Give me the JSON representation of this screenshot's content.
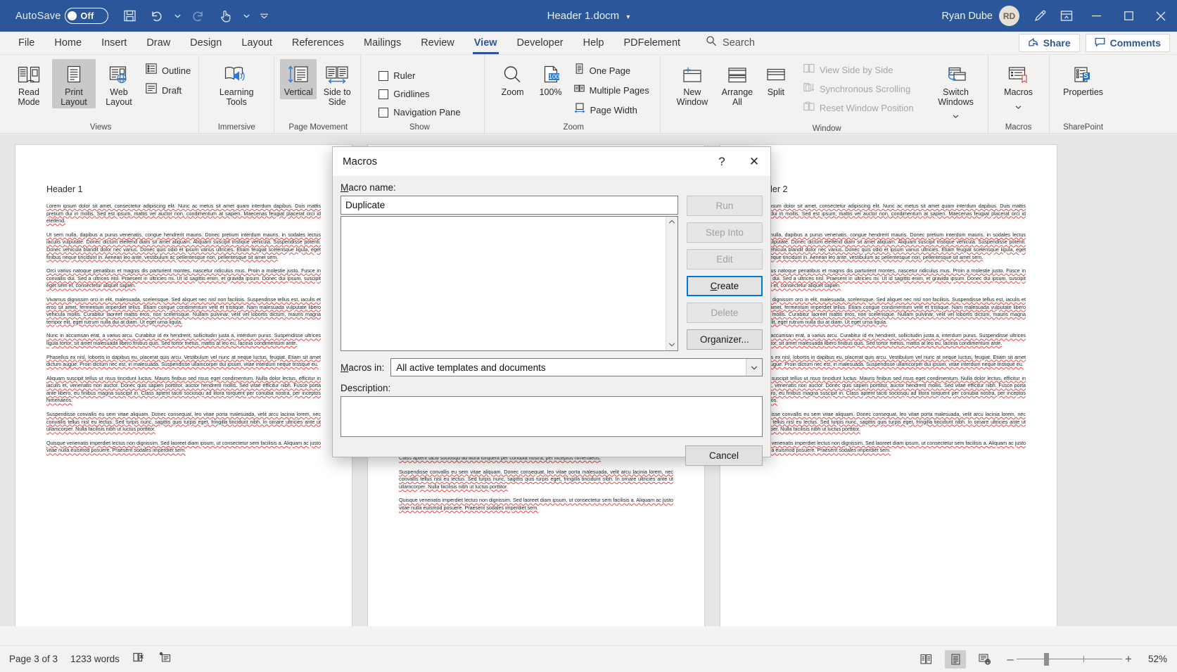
{
  "titlebar": {
    "autosave_label": "AutoSave",
    "autosave_state": "Off",
    "save_icon": "save-icon",
    "undo_icon": "undo-icon",
    "redo_icon": "redo-icon",
    "touch_icon": "touch-mode-icon",
    "customize_icon": "customize-quick-access-icon",
    "document_title": "Header 1.docm",
    "title_caret": "▾",
    "user_name": "Ryan Dube",
    "avatar_initials": "RD",
    "pen_icon": "ink-pen-icon",
    "ribbon_display_icon": "ribbon-display-options-icon",
    "minimize": "–",
    "maximize": "□",
    "close": "✕"
  },
  "tabs": [
    {
      "label": "File",
      "active": false
    },
    {
      "label": "Home",
      "active": false
    },
    {
      "label": "Insert",
      "active": false
    },
    {
      "label": "Draw",
      "active": false
    },
    {
      "label": "Design",
      "active": false
    },
    {
      "label": "Layout",
      "active": false
    },
    {
      "label": "References",
      "active": false
    },
    {
      "label": "Mailings",
      "active": false
    },
    {
      "label": "Review",
      "active": false
    },
    {
      "label": "View",
      "active": true
    },
    {
      "label": "Developer",
      "active": false
    },
    {
      "label": "Help",
      "active": false
    },
    {
      "label": "PDFelement",
      "active": false
    }
  ],
  "search": {
    "placeholder": "Search",
    "icon": "search-icon"
  },
  "tabbar_right": {
    "share_label": "Share",
    "share_icon": "share-icon",
    "comments_label": "Comments",
    "comments_icon": "comment-icon"
  },
  "ribbon": {
    "groups": [
      {
        "label": "Views",
        "items": [
          {
            "label": "Read Mode",
            "selected": false,
            "icon": "read-mode-icon"
          },
          {
            "label": "Print Layout",
            "selected": true,
            "icon": "print-layout-icon"
          },
          {
            "label": "Web Layout",
            "selected": false,
            "icon": "web-layout-icon"
          }
        ],
        "small_items": [
          {
            "label": "Outline",
            "icon": "outline-icon"
          },
          {
            "label": "Draft",
            "icon": "draft-icon"
          }
        ]
      },
      {
        "label": "Immersive",
        "items": [
          {
            "label": "Learning Tools",
            "selected": false,
            "icon": "learning-tools-icon"
          }
        ],
        "small_items": []
      },
      {
        "label": "Page Movement",
        "items": [
          {
            "label": "Vertical",
            "selected": true,
            "icon": "vertical-scroll-icon"
          },
          {
            "label": "Side to Side",
            "selected": false,
            "icon": "side-to-side-icon"
          }
        ],
        "small_items": []
      },
      {
        "label": "Show",
        "items": [],
        "small_items": [
          {
            "label": "Ruler",
            "checked": false,
            "icon": "checkbox-icon"
          },
          {
            "label": "Gridlines",
            "checked": false,
            "icon": "checkbox-icon"
          },
          {
            "label": "Navigation Pane",
            "checked": false,
            "icon": "checkbox-icon"
          }
        ]
      },
      {
        "label": "Zoom",
        "items": [
          {
            "label": "Zoom",
            "selected": false,
            "icon": "magnifier-icon"
          },
          {
            "label": "100%",
            "selected": false,
            "icon": "zoom-100-icon"
          }
        ],
        "small_items": [
          {
            "label": "One Page",
            "icon": "one-page-icon"
          },
          {
            "label": "Multiple Pages",
            "icon": "multiple-pages-icon"
          },
          {
            "label": "Page Width",
            "icon": "page-width-icon"
          }
        ]
      },
      {
        "label": "Window",
        "items": [
          {
            "label": "New Window",
            "selected": false,
            "icon": "new-window-icon"
          },
          {
            "label": "Arrange All",
            "selected": false,
            "icon": "arrange-all-icon"
          },
          {
            "label": "Split",
            "selected": false,
            "icon": "split-icon"
          },
          {
            "label": "Switch Windows",
            "selected": false,
            "icon": "switch-windows-icon"
          }
        ],
        "small_items": [
          {
            "label": "View Side by Side",
            "disabled": true,
            "icon": "view-side-by-side-icon"
          },
          {
            "label": "Synchronous Scrolling",
            "disabled": true,
            "icon": "synchronous-scrolling-icon"
          },
          {
            "label": "Reset Window Position",
            "disabled": true,
            "icon": "reset-window-position-icon"
          }
        ]
      },
      {
        "label": "Macros",
        "items": [
          {
            "label": "Macros",
            "selected": false,
            "icon": "macros-icon"
          }
        ],
        "small_items": []
      },
      {
        "label": "SharePoint",
        "items": [
          {
            "label": "Properties",
            "selected": false,
            "icon": "sharepoint-properties-icon"
          }
        ],
        "small_items": []
      }
    ]
  },
  "dialog": {
    "title": "Macros",
    "help_icon": "?",
    "close_icon": "✕",
    "macro_name_label": "Macro name:",
    "macro_name_value": "Duplicate",
    "list_items": [],
    "scroll_up": "⌃",
    "scroll_down": "⌄",
    "buttons": [
      {
        "label": "Run",
        "state": "disabled"
      },
      {
        "label": "Step Into",
        "state": "disabled"
      },
      {
        "label": "Edit",
        "state": "disabled"
      },
      {
        "label": "Create",
        "state": "primary",
        "accesskey": "C"
      },
      {
        "label": "Delete",
        "state": "disabled"
      },
      {
        "label": "Organizer...",
        "state": "enabled",
        "accesskey": "g"
      }
    ],
    "macros_in_label": "Macros in:",
    "macros_in_value": "All active templates and documents",
    "macros_in_caret": "⌄",
    "description_label": "Description:",
    "description_value": "",
    "cancel_label": "Cancel"
  },
  "document": {
    "pages": [
      {
        "heading": "Header 1",
        "paragraphs": [
          "Lorem ipsum dolor sit amet, consectetur adipiscing elit. Nunc ac metus sit amet quam interdum dapibus. Duis mattis pretium dui in mollis. Sed est ipsum, mattis vel auctor non, condimentum at sapien. Maecenas feugiat placerat orci id eleifend.",
          "Ut sem nulla, dapibus a purus venenatis, congue hendrerit mauris. Donec pretium interdum mauris, in sodales lectus iaculis vulputate. Donec dictum eleifend diam sit amet aliquam. Aliquam suscipit tristique vehicula. Suspendisse potenti. Donec vehicula blandit dolor nec varius. Donec quis odio et ipsum varius ultricies. Etiam feugiat scelerisque ligula, eget finibus neque tincidunt in. Aenean leo ante, vestibulum ac pellentesque non, pellentesque sit amet sem.",
          "Orci varius natoque penatibus et magnis dis parturient montes, nascetur ridiculus mus. Proin a molestie justo. Fusce in convallis dui. Sed a ultrices nisl. Praesent in ultricies mi. Ut id sagittis enim, et gravida ipsum. Donec dui ipsum, suscipit eget sem et, consectetur aliquet sapien.",
          "Vivamus dignissim orci in elit, malesuada, scelerisque. Sed aliquet nec nisl non facilisis. Suspendisse tellus est, iaculis et eros sit amet, fermentum imperdiet tellus. Etiam congue condimentum velit et tristique. Nam malesuada vulputate libero vehicula mollis. Curabitur laoreet mattis eros, non scelerisque. Nullam pulvinar, velit vel lobortis dictum, mauris magna tempor elit, eget rutrum nulla dui at diam. Ut eget urna ligula.",
          "Nunc in accumsan erat, a varius arcu. Curabitur id ex hendrerit, sollicitudin justa a, interdum purus. Suspendisse ultrices ligula tortor, sit amet malesuada libero finibus quis. Sed tortor metus, mattis at leo eu, lacinia condimentum ante.",
          "Phasellus ex nisl, lobortis in dapibus eu, placerat quis arcu. Vestibulum vel nunc at neque luctus, feugiat. Etiam sit amet dictum augue. Proin dictum nec est, in malesuada. Suspendisse ullamcorper dui ipsum, vitae interdum neque tristique eu.",
          "Aliquam suscipit tellus ut risus tincidunt luctus. Mauris finibus sed risus eget condimentum. Nulla dolor lectus, efficitur in iaculis et, venenatis non auctor. Donec quis sapien porttitor, auctor hendrerit mollis. Sed vitae efficitur nibh. Fusce porta ante libero, eu finibus magna suscipit in. Class aptent taciti sociosqu ad litora torquent per conubia nostra, per inceptos himenaeos.",
          "Suspendisse convallis eu sem vitae aliquam. Donec consequat, leo vitae porta malesuada, velit arcu lacinia lorem, nec convallis tellus nisl eu lectus. Sed turpis nunc, sagittis quis turpis eget, fringilla tincidunt nibh. In ornare ultricies ante ut ullamcorper. Nulla facilisis nibh ut luctus porttitor.",
          "Quisque venenatis imperdiet lectus non dignissim. Sed laoreet diam ipsum, ut consectetur sem facilisis a. Aliquam ac justo vitae nulla euismod posuere. Praesent sodales imperdiet sem."
        ]
      },
      {
        "heading": "",
        "paragraphs": [
          "Class aptent taciti sociosqu ad litora torquent per conubia nostra, per inceptos himenaeos.",
          "Suspendisse convallis eu sem vitae aliquam. Donec consequat, leo vitae porta malesuada, velit arcu lacinia lorem, nec convallis tellus nisl eu lectus. Sed turpis nunc, sagittis quis turpis eget, fringilla tincidunt nibh. In ornare ultricies ante ut ullamcorper. Nulla facilisis nibh ut luctus porttitor.",
          "Quisque venenatis imperdiet lectus non dignissim. Sed laoreet diam ipsum, ut consectetur sem facilisis a. Aliquam ac justo vitae nulla euismod posuere. Praesent sodales imperdiet sem."
        ]
      },
      {
        "heading": "Header 2",
        "paragraphs": [
          "Lorem ipsum dolor sit amet, consectetur adipiscing elit. Nunc ac metus sit amet quam interdum dapibus. Duis mattis pretium dui in mollis. Sed est ipsum, mattis vel auctor non, condimentum at sapien. Maecenas feugiat placerat orci id eleifend.",
          "Ut sem nulla, dapibus a purus venenatis, congue hendrerit mauris. Donec pretium interdum mauris, in sodales lectus iaculis vulputate. Donec dictum eleifend diam sit amet aliquam. Aliquam suscipit tristique vehicula. Suspendisse potenti. Donec vehicula blandit dolor nec varius. Donec quis odio et ipsum varius ultricies. Etiam feugiat scelerisque ligula, eget finibus neque tincidunt in. Aenean leo ante, vestibulum ac pellentesque non, pellentesque sit amet sem.",
          "Orci varius natoque penatibus et magnis dis parturient montes, nascetur ridiculus mus. Proin a molestie justo. Fusce in convallis dui. Sed a ultrices nisl. Praesent in ultricies mi. Ut id sagittis enim, et gravida ipsum. Donec dui ipsum, suscipit eget sem et, consectetur aliquet sapien.",
          "Vivamus dignissim orci in elit, malesuada, scelerisque. Sed aliquet nec nisl non facilisis. Suspendisse tellus est, iaculis et eros sit amet, fermentum imperdiet tellus. Etiam congue condimentum velit et tristique. Nam malesuada vulputate libero vehicula mollis. Curabitur laoreet mattis eros, non scelerisque. Nullam pulvinar, velit vel lobortis dictum, mauris magna tempor elit, eget rutrum nulla dui at diam. Ut eget urna ligula.",
          "Nunc in accumsan erat, a varius arcu. Curabitur id ex hendrerit, sollicitudin justa a, interdum purus. Suspendisse ultrices ligula tortor, sit amet malesuada libero finibus quis. Sed tortor metus, mattis at leo eu, lacinia condimentum ante.",
          "Phasellus ex nisl, lobortis in dapibus eu, placerat quis arcu. Vestibulum vel nunc at neque luctus, feugiat. Etiam sit amet dictum augue. Proin dictum nec est, in malesuada. Suspendisse ullamcorper dui ipsum, vitae interdum neque tristique eu.",
          "Aliquam suscipit tellus ut risus tincidunt luctus. Mauris finibus sed risus eget condimentum. Nulla dolor lectus, efficitur in iaculis et, venenatis non auctor. Donec quis sapien porttitor, auctor hendrerit mollis. Sed vitae efficitur nibh. Fusce porta ante libero, eu finibus magna suscipit in. Class aptent taciti sociosqu ad litora torquent per conubia nostra, per inceptos himenaeos.",
          "Suspendisse convallis eu sem vitae aliquam. Donec consequat, leo vitae porta malesuada, velit arcu lacinia lorem, nec convallis tellus nisl eu lectus. Sed turpis nunc, sagittis quis turpis eget, fringilla tincidunt nibh. In ornare ultricies ante ut ullamcorper. Nulla facilisis nibh ut luctus porttitor.",
          "Quisque venenatis imperdiet lectus non dignissim. Sed laoreet diam ipsum, ut consectetur sem facilisis a. Aliquam ac justo vitae nulla euismod posuere. Praesent sodales imperdiet sem."
        ]
      }
    ]
  },
  "statusbar": {
    "page_info": "Page 3 of 3",
    "word_count": "1233 words",
    "proofing_icon": "proofing-errors-icon",
    "accessibility_icon": "accessibility-checker-icon",
    "view_read_icon": "read-mode-view-icon",
    "view_print_icon": "print-layout-view-icon",
    "view_web_icon": "web-layout-view-icon",
    "zoom_out": "–",
    "zoom_in": "+",
    "zoom_percent": "52%"
  },
  "colors": {
    "word_blue": "#2b579a",
    "accent_blue": "#0078d7",
    "ribbon_bg": "#f3f2f1",
    "canvas_bg": "#e6e6e6",
    "spell_error": "#e64646"
  }
}
